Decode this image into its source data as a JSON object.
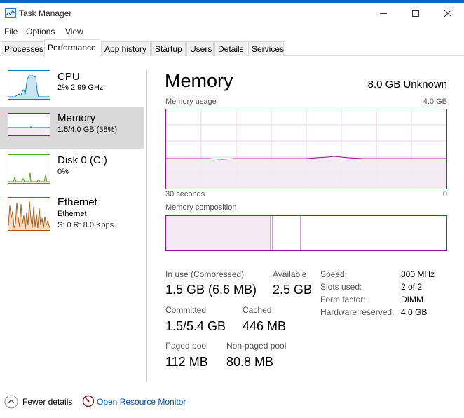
{
  "window": {
    "title": "Task Manager",
    "accent_color": "#1565c0"
  },
  "menu": [
    "File",
    "Options",
    "View"
  ],
  "tabs": [
    "Processes",
    "Performance",
    "App history",
    "Startup",
    "Users",
    "Details",
    "Services"
  ],
  "active_tab": "Performance",
  "sidebar": {
    "items": [
      {
        "name": "CPU",
        "line1": "2%  2.99 GHz",
        "line2": "",
        "color": "#117dbb",
        "icon": "cpu-graph-icon"
      },
      {
        "name": "Memory",
        "line1": "1.5/4.0 GB (38%)",
        "line2": "",
        "color": "#8b1e8b",
        "icon": "memory-graph-icon"
      },
      {
        "name": "Disk 0 (C:)",
        "line1": "0%",
        "line2": "",
        "color": "#4da60c",
        "icon": "disk-graph-icon"
      },
      {
        "name": "Ethernet",
        "line1": "Ethernet",
        "line2": "S: 0  R: 8.0 Kbps",
        "color": "#a74f01",
        "icon": "ethernet-graph-icon"
      }
    ],
    "selected": "Memory"
  },
  "panel": {
    "title": "Memory",
    "subtitle": "8.0 GB Unknown",
    "usage_label": "Memory usage",
    "usage_max": "4.0 GB",
    "axis_left": "30 seconds",
    "axis_right": "0",
    "composition_label": "Memory composition",
    "usage_fraction": 0.38
  },
  "stats": {
    "in_use_label": "In use (Compressed)",
    "in_use_value": "1.5 GB (6.6 MB)",
    "available_label": "Available",
    "available_value": "2.5 GB",
    "committed_label": "Committed",
    "committed_value": "1.5/5.4 GB",
    "cached_label": "Cached",
    "cached_value": "446 MB",
    "paged_label": "Paged pool",
    "paged_value": "112 MB",
    "nonpaged_label": "Non-paged pool",
    "nonpaged_value": "80.8 MB"
  },
  "specs": {
    "speed_label": "Speed:",
    "speed_value": "800 MHz",
    "slots_label": "Slots used:",
    "slots_value": "2 of 2",
    "form_label": "Form factor:",
    "form_value": "DIMM",
    "hwres_label": "Hardware reserved:",
    "hwres_value": "4.0 GB"
  },
  "footer": {
    "fewer_details": "Fewer details",
    "resource_monitor": "Open Resource Monitor"
  }
}
